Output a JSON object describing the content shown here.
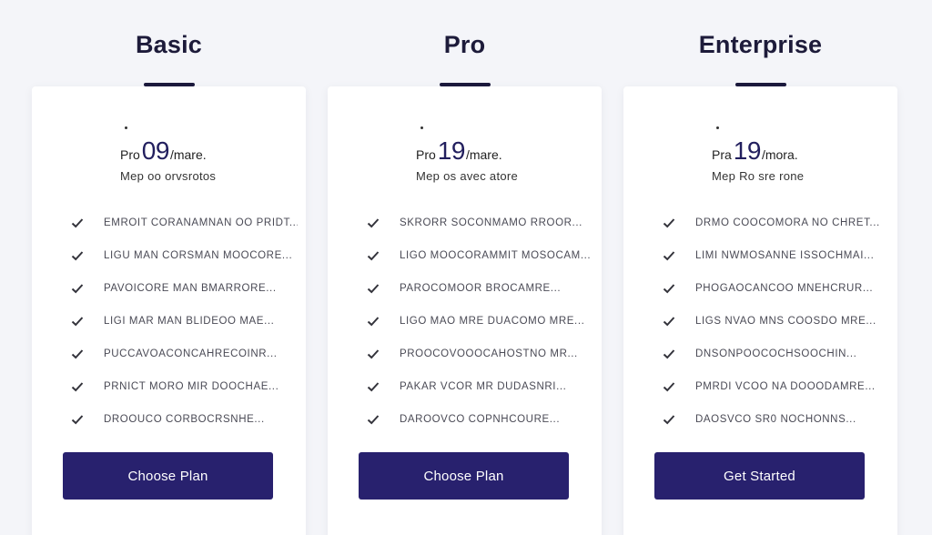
{
  "colors": {
    "background": "#f4f5f9",
    "card": "#ffffff",
    "button": "#28216e",
    "title": "#1d1b3a",
    "price": "#221f5e"
  },
  "icons": {
    "feature_check": "check-icon"
  },
  "plans": [
    {
      "name": "Basic",
      "price_prefix": "Pro",
      "price_amount": "09",
      "price_suffix": "/mare.",
      "price_subtext": "Mep oo orvsrotos",
      "features": [
        "EMROIT CORANAMNAN OO PRIDT...",
        "LIGU MAN CORSMAN MOOCORE...",
        "PAVOICORE MAN BMARRORE...",
        "LIGI MAR MAN BLIDEOO MAE...",
        "PUCCAVOACONCAHRECOINR...",
        "PRNICT MORO MIR DOOCHAE...",
        "DROOUCO CORBOCRSNHE..."
      ],
      "cta_label": "Choose Plan"
    },
    {
      "name": "Pro",
      "price_prefix": "Pro",
      "price_amount": "19",
      "price_suffix": "/mare.",
      "price_subtext": "Mep os avec atore",
      "features": [
        "SKRORR SOCONMAMO RROOR...",
        "LIGO MOOCORAMMIT MOSOCAM...",
        "PAROCOMOOR BROCAMRE...",
        "LIGO MAO MRE DUACOMO MRE...",
        "PROOCOVOOOCAHOSTNO MR...",
        "PAKAR VCOR MR DUDASNRI...",
        "DAROOVCO COPNHCOURE..."
      ],
      "cta_label": "Choose Plan"
    },
    {
      "name": "Enterprise",
      "price_prefix": "Pra",
      "price_amount": "19",
      "price_suffix": "/mora.",
      "price_subtext": "Mep Ro sre rone",
      "features": [
        "DRMO COOCOMORA NO CHRET...",
        "LIMI NWMOSANNE ISSOCHMAI...",
        "PHOGAOCANCOO MNEHCRUR...",
        "LIGS NVAO MNS COOSDO MRE...",
        "DNSONPOOCOCHSOOCHIN...",
        "PMRDI VCOO NA DOOODAMRE...",
        "DAOSVCO SR0 NOCHONNS..."
      ],
      "cta_label": "Get Started"
    }
  ]
}
